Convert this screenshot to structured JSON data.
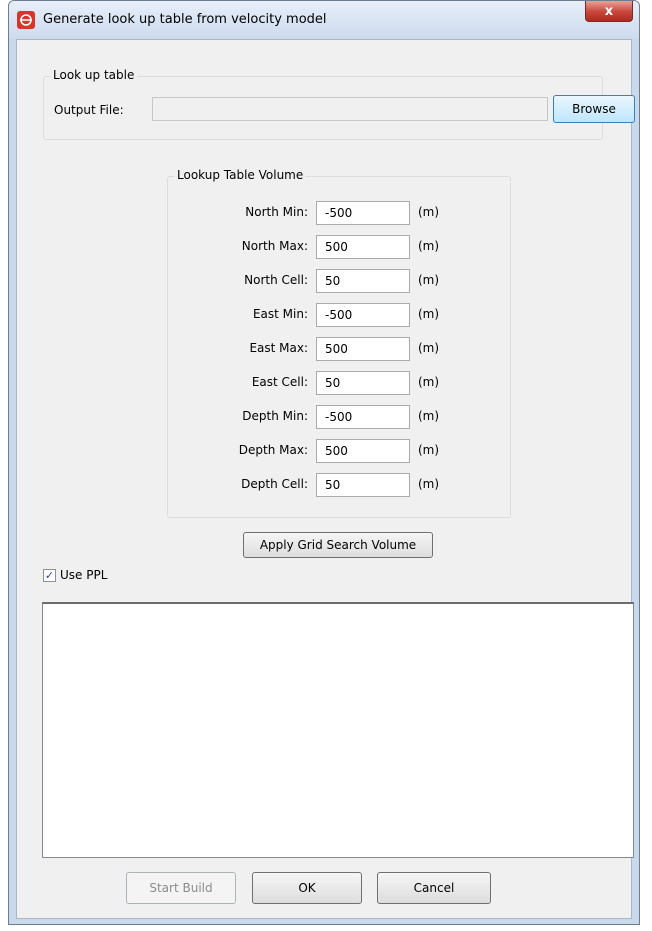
{
  "window": {
    "title": "Generate look up table from velocity model",
    "close_label": "x"
  },
  "lookup_group": {
    "title": "Look up table",
    "output_label": "Output File:",
    "output_value": "",
    "browse_label": "Browse"
  },
  "volume_group": {
    "title": "Lookup Table Volume",
    "rows": [
      {
        "label": "North Min:",
        "value": "-500",
        "unit": "(m)"
      },
      {
        "label": "North Max:",
        "value": "500",
        "unit": "(m)"
      },
      {
        "label": "North Cell:",
        "value": "50",
        "unit": "(m)"
      },
      {
        "label": "East Min:",
        "value": "-500",
        "unit": "(m)"
      },
      {
        "label": "East Max:",
        "value": "500",
        "unit": "(m)"
      },
      {
        "label": "East Cell:",
        "value": "50",
        "unit": "(m)"
      },
      {
        "label": "Depth Min:",
        "value": "-500",
        "unit": "(m)"
      },
      {
        "label": "Depth Max:",
        "value": "500",
        "unit": "(m)"
      },
      {
        "label": "Depth Cell:",
        "value": "50",
        "unit": "(m)"
      }
    ]
  },
  "apply_button": "Apply Grid Search Volume",
  "use_ppl": {
    "label": "Use PPL",
    "checked": true
  },
  "footer": {
    "start_build": "Start Build",
    "ok": "OK",
    "cancel": "Cancel"
  }
}
